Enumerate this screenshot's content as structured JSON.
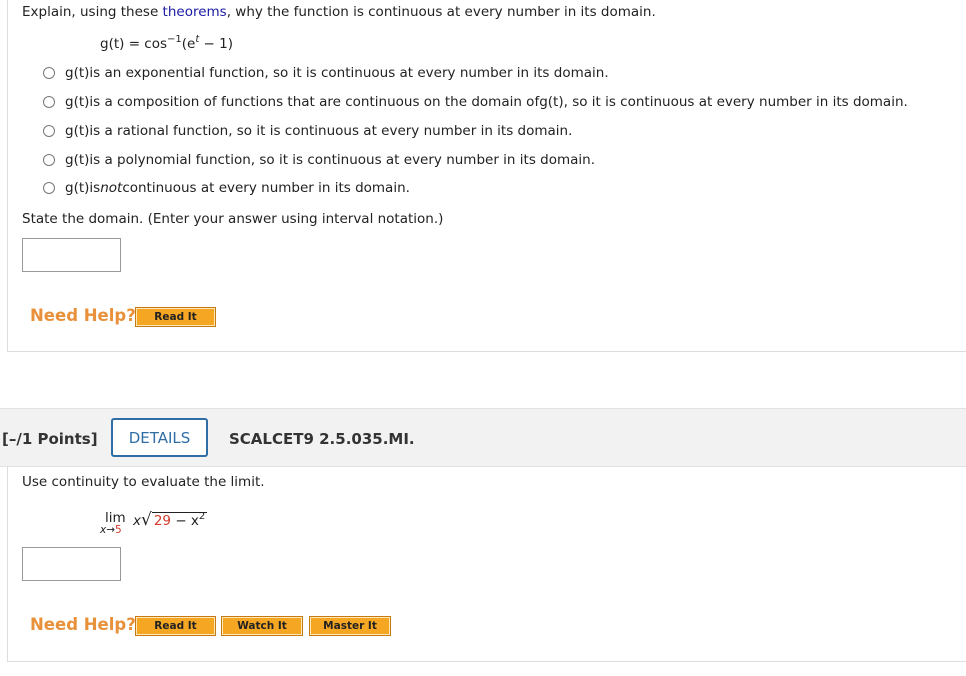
{
  "q1": {
    "prompt_prefix": "Explain, using these ",
    "prompt_link": "theorems",
    "prompt_suffix": ", why the function is continuous at every number in its domain.",
    "formula": {
      "lhs": "g(t) = cos",
      "exp": "−1",
      "mid": "(e",
      "exp2": "t",
      "rhs": " − 1)"
    },
    "options": [
      {
        "fn": "g(t)",
        "text": " is an exponential function, so it is continuous at every number in its domain."
      },
      {
        "fn": "g(t)",
        "text": " is a composition of functions that are continuous on the domain of ",
        "fn2": "g(t)",
        "text2": ", so it is continuous at every number in its domain."
      },
      {
        "fn": "g(t)",
        "text": " is a rational function, so it is continuous at every number in its domain."
      },
      {
        "fn": "g(t)",
        "text": " is a polynomial function, so it is continuous at every number in its domain."
      },
      {
        "fn": "g(t)",
        "text": " is ",
        "em": "not",
        "text2": " continuous at every number in its domain."
      }
    ],
    "domain_prompt": "State the domain. (Enter your answer using interval notation.)",
    "answer_value": "",
    "need_help": "Need Help?",
    "read_it": "Read It"
  },
  "q2": {
    "points": "[–/1 Points]",
    "details": "DETAILS",
    "code": "SCALCET9 2.5.035.MI.",
    "prompt": "Use continuity to evaluate the limit.",
    "limit": {
      "lim": "lim",
      "sub_var": "x",
      "sub_arrow": "→",
      "sub_val": "5",
      "x": "x",
      "radicand_num": "29",
      "radicand_rest": " − x",
      "radicand_exp": "2"
    },
    "answer_value": "",
    "need_help": "Need Help?",
    "read_it": "Read It",
    "watch_it": "Watch It",
    "master_it": "Master It"
  },
  "colors": {
    "accent_orange": "#e8913a",
    "button_orange": "#f5a623",
    "details_blue": "#2f6ea5",
    "link_blue": "#1a1aa6",
    "limit_red": "#d23a2a"
  }
}
